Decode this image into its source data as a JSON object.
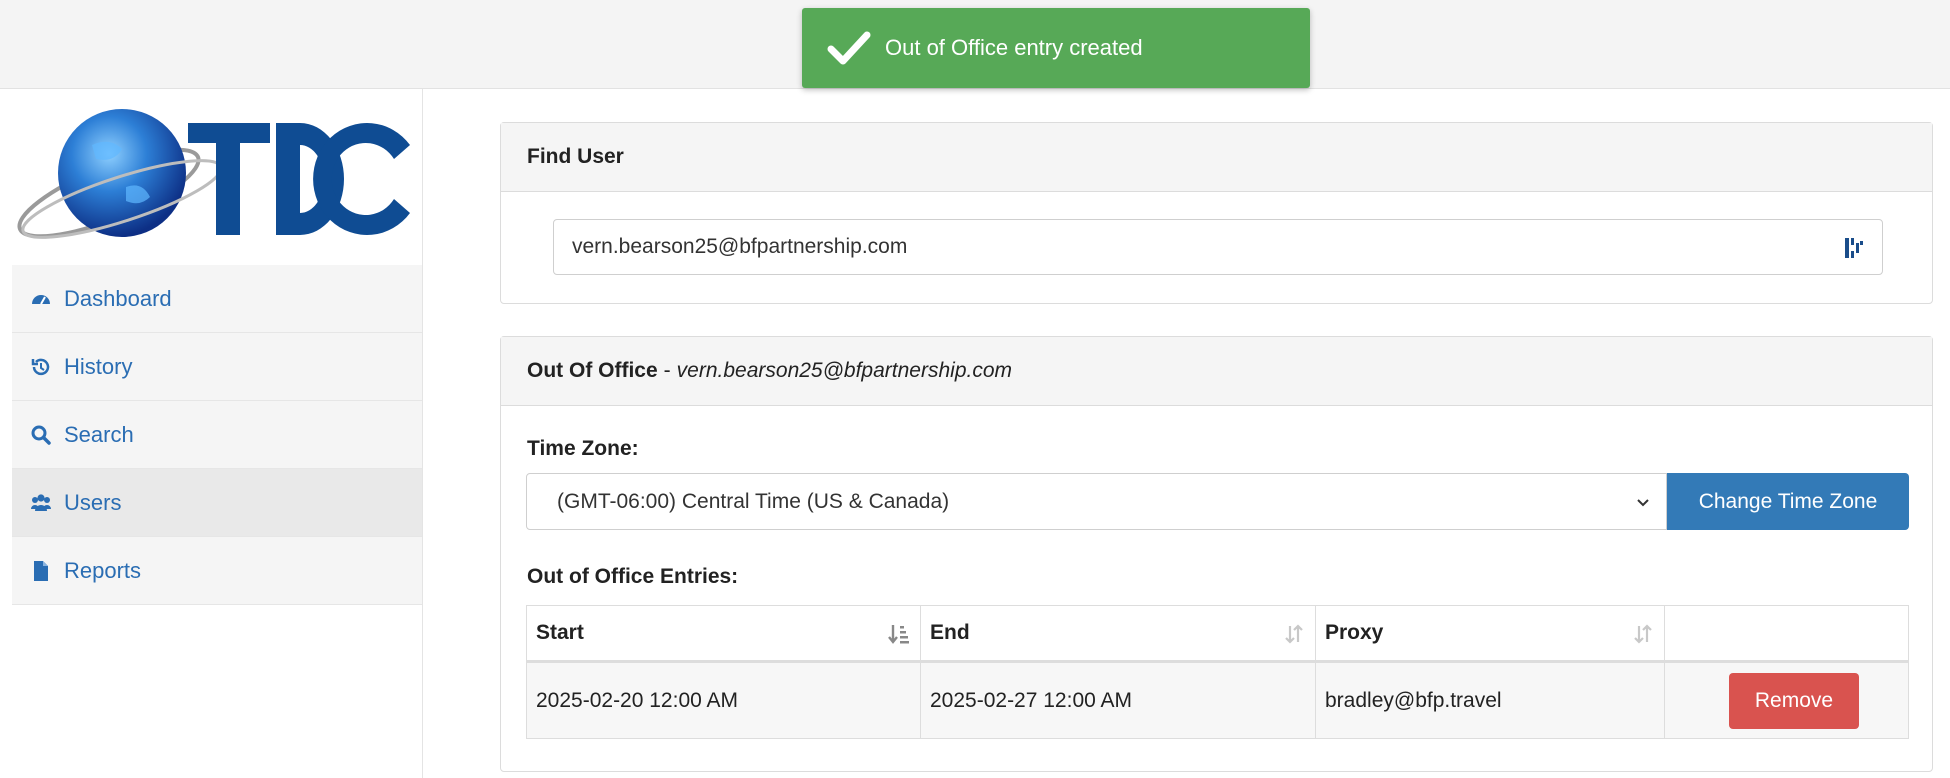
{
  "toast": {
    "message": "Out of Office entry created",
    "icon": "check-icon",
    "color": "#57a957"
  },
  "sidebar": {
    "logo_text": "TDC",
    "items": [
      {
        "label": "Dashboard",
        "icon": "dashboard-icon"
      },
      {
        "label": "History",
        "icon": "history-icon"
      },
      {
        "label": "Search",
        "icon": "search-icon"
      },
      {
        "label": "Users",
        "icon": "users-icon",
        "active": true
      },
      {
        "label": "Reports",
        "icon": "file-icon"
      }
    ]
  },
  "find_user": {
    "title": "Find User",
    "input_value": "vern.bearson25@bfpartnership.com"
  },
  "out_of_office": {
    "title": "Out Of Office",
    "separator": "-",
    "user": "vern.bearson25@bfpartnership.com",
    "timezone_label": "Time Zone:",
    "timezone_value": "(GMT-06:00) Central Time (US & Canada)",
    "change_timezone_label": "Change Time Zone",
    "entries_label": "Out of Office Entries:",
    "columns": [
      "Start",
      "End",
      "Proxy",
      ""
    ],
    "rows": [
      {
        "start": "2025-02-20 12:00 AM",
        "end": "2025-02-27 12:00 AM",
        "proxy": "bradley@bfp.travel",
        "action": "Remove"
      }
    ]
  },
  "colors": {
    "primary": "#337ab7",
    "danger": "#d9534f",
    "success": "#57a957",
    "link": "#2a6db3"
  }
}
